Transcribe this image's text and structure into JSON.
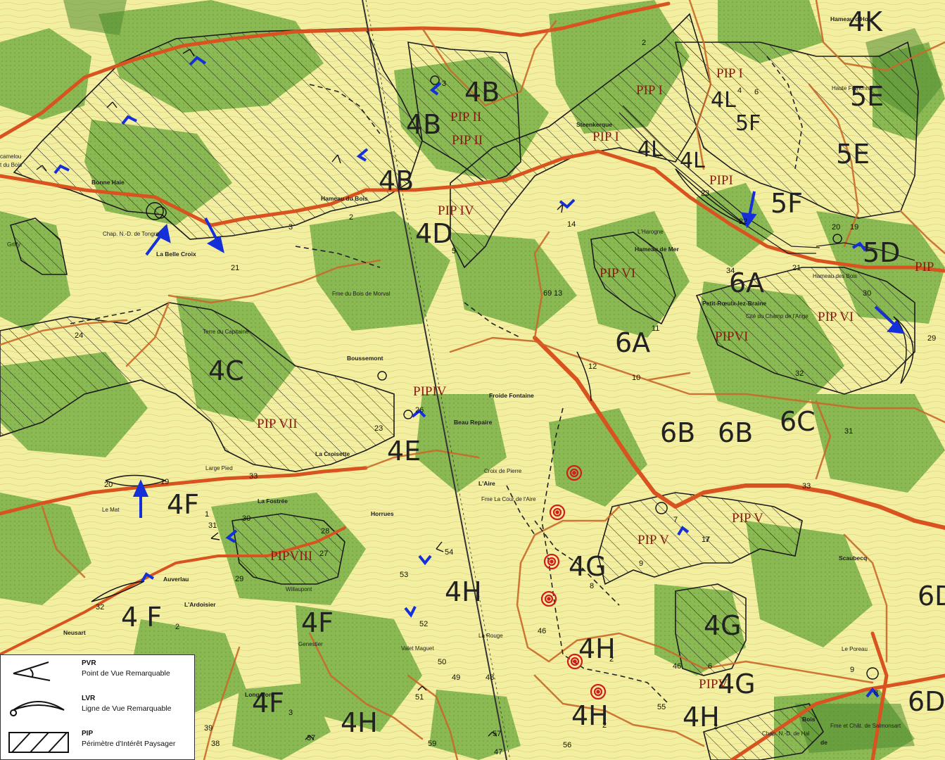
{
  "colors": {
    "background": "#f3efa0",
    "forest": "#7fb34a",
    "forest_dark": "#4e8a2f",
    "road_major": "#d8531f",
    "road_minor": "#c86a2a",
    "boundary": "#1b1b1b",
    "arrow": "#1530d8",
    "target": "#d21c1c"
  },
  "zones": {
    "z4K": "4K",
    "z5E_a": "5E",
    "z5E_b": "5E",
    "z5F_a": "5F",
    "z5F_b": "5F",
    "z5D": "5D",
    "z4L_a": "4L",
    "z4L_b": "4L",
    "z4L_c": "4L",
    "z4B_a": "4B",
    "z4B_b": "4B",
    "z4B_c": "4B",
    "z4D": "4D",
    "z6A_a": "6A",
    "z6A_b": "6A",
    "z4C": "4C",
    "z4E": "4E",
    "z6B_a": "6B",
    "z6B_b": "6B",
    "z6C": "6C",
    "z4F1": "4F",
    "z4F1_sub": "1",
    "z4F2": "4 F",
    "z4F2_sub": "2",
    "z4F": "4F",
    "z4F3": "4F",
    "z4F3_sub": "3",
    "z4G_a": "4G",
    "z4G_b": "4G",
    "z4G_c": "4G",
    "z4H_a": "4H",
    "z4H_b": "4H",
    "z4H2_a": "4H",
    "z4H2_a_sub": "2",
    "z4H2_b": "4H",
    "z4H2_b_sub": "2",
    "z4H2_c": "4H",
    "z4H2_c_sub": "2",
    "z6D_a": "6D",
    "z6D_b": "6D"
  },
  "pip_labels": {
    "p_I_a": "PIP I",
    "p_I_b": "PIP I",
    "p_I_c": "PIP I",
    "p_I_d": "PIPI",
    "p_II_a": "PIP II",
    "p_II_b": "PIP II",
    "p_IV_a": "PIP IV",
    "p_IV_b": "PIPIV",
    "p_VI_a": "PIP VI",
    "p_VI_b": "PIP VI",
    "p_VI_c": "PIPVI",
    "p_VI_d": "PIP",
    "p_VII": "PIP VII",
    "p_VIII": "PIPVIII",
    "p_V_a": "PIP V",
    "p_V_b": "PIP V",
    "p_V_c": "PIPV"
  },
  "places": {
    "steenkerque": "Steenkerque",
    "petit_roeulx": "Petit-Rœulx-lez-Braine",
    "horrues": "Horrues",
    "hameau_bois": "Hameau du Bois",
    "hameau_mer": "Hameau de Mer",
    "hameau_hou": "Hameau d'Hou",
    "hameau_des_bois": "Hameau des Bois",
    "bonne_haie": "Bonne Haie",
    "belle_croix": "La Belle Croix",
    "boussemont": "Boussemont",
    "froide_fontaine": "Froide Fontaine",
    "beau_repaire": "Beau Repaire",
    "laire": "L'Aire",
    "la_fostree": "La Fostrée",
    "auverlau": "Auverlau",
    "lardoisier": "L'Ardoisier",
    "neusart": "Neusart",
    "genestier": "Genestier",
    "willaupont": "Willaupont",
    "long_pont": "Long Pont",
    "scaubecq": "Scaubecq",
    "le_poreau": "Le Poreau",
    "haute_franchise": "Haute Franchise",
    "la_croisette": "La Croisette",
    "large_pied": "Large Pied",
    "terre_capitaine": "Terre du Capitaine",
    "chap_tongre": "Chap. N.-D. de Tongre",
    "chap_hal": "Chap. N.-D. de Hal",
    "bois": "Bois",
    "de": "de",
    "fme_salmonsart": "Fme et Chât. de Salmonsart",
    "fme_bois_morval": "Fme du Bois de Morval",
    "lharogne": "L'Harogne",
    "le_mat": "Le Mat",
    "camelou": "camelou",
    "du_bois": "t du Bois",
    "cite_champ": "Cité du Champ de l'Ange",
    "croix_pierre": "Croix de Pierre",
    "ferme_cour": "Fme La Cour de l'Aire",
    "rouge": "La Rouge",
    "valet_magnet": "Valet Maguet",
    "griffy": "Griffy"
  },
  "numbers": {
    "n1": "1",
    "n2": "2",
    "n2b": "2",
    "n3": "3",
    "n3b": "3",
    "n4": "4",
    "n5": "5",
    "n6": "6",
    "n6b": "6",
    "n7": "7",
    "n7b": "7",
    "n8": "8",
    "n8b": "8",
    "n9": "9",
    "n9b": "9",
    "n10": "10",
    "n11": "11",
    "n12": "12",
    "n13": "13",
    "n14": "14",
    "n17": "17",
    "n19": "19",
    "n19b": "19",
    "n20": "20",
    "n20b": "20",
    "n21": "21",
    "n21b": "21",
    "n22": "22",
    "n23": "23",
    "n23b": "23",
    "n24": "24",
    "n26": "26",
    "n27": "27",
    "n28": "28",
    "n29": "29",
    "n29b": "29",
    "n30": "30",
    "n30b": "30",
    "n31": "31",
    "n31b": "31",
    "n32": "32",
    "n32b": "32",
    "n33": "33",
    "n33b": "33",
    "n34": "34",
    "n37": "37",
    "n38": "38",
    "n39": "39",
    "n46": "46",
    "n46b": "46",
    "n47": "47",
    "n48": "48",
    "n49": "49",
    "n50": "50",
    "n51": "51",
    "n52": "52",
    "n53": "53",
    "n54": "54",
    "n55": "55",
    "n56": "56",
    "n57": "57",
    "n59": "59",
    "n69": "69"
  },
  "legend": {
    "pvr_code": "PVR",
    "pvr_desc": "Point de Vue Remarquable",
    "lvr_code": "LVR",
    "lvr_desc": "Ligne de Vue Remarquable",
    "pip_code": "PIP",
    "pip_desc": "Périmètre d'Intérêt Paysager"
  }
}
